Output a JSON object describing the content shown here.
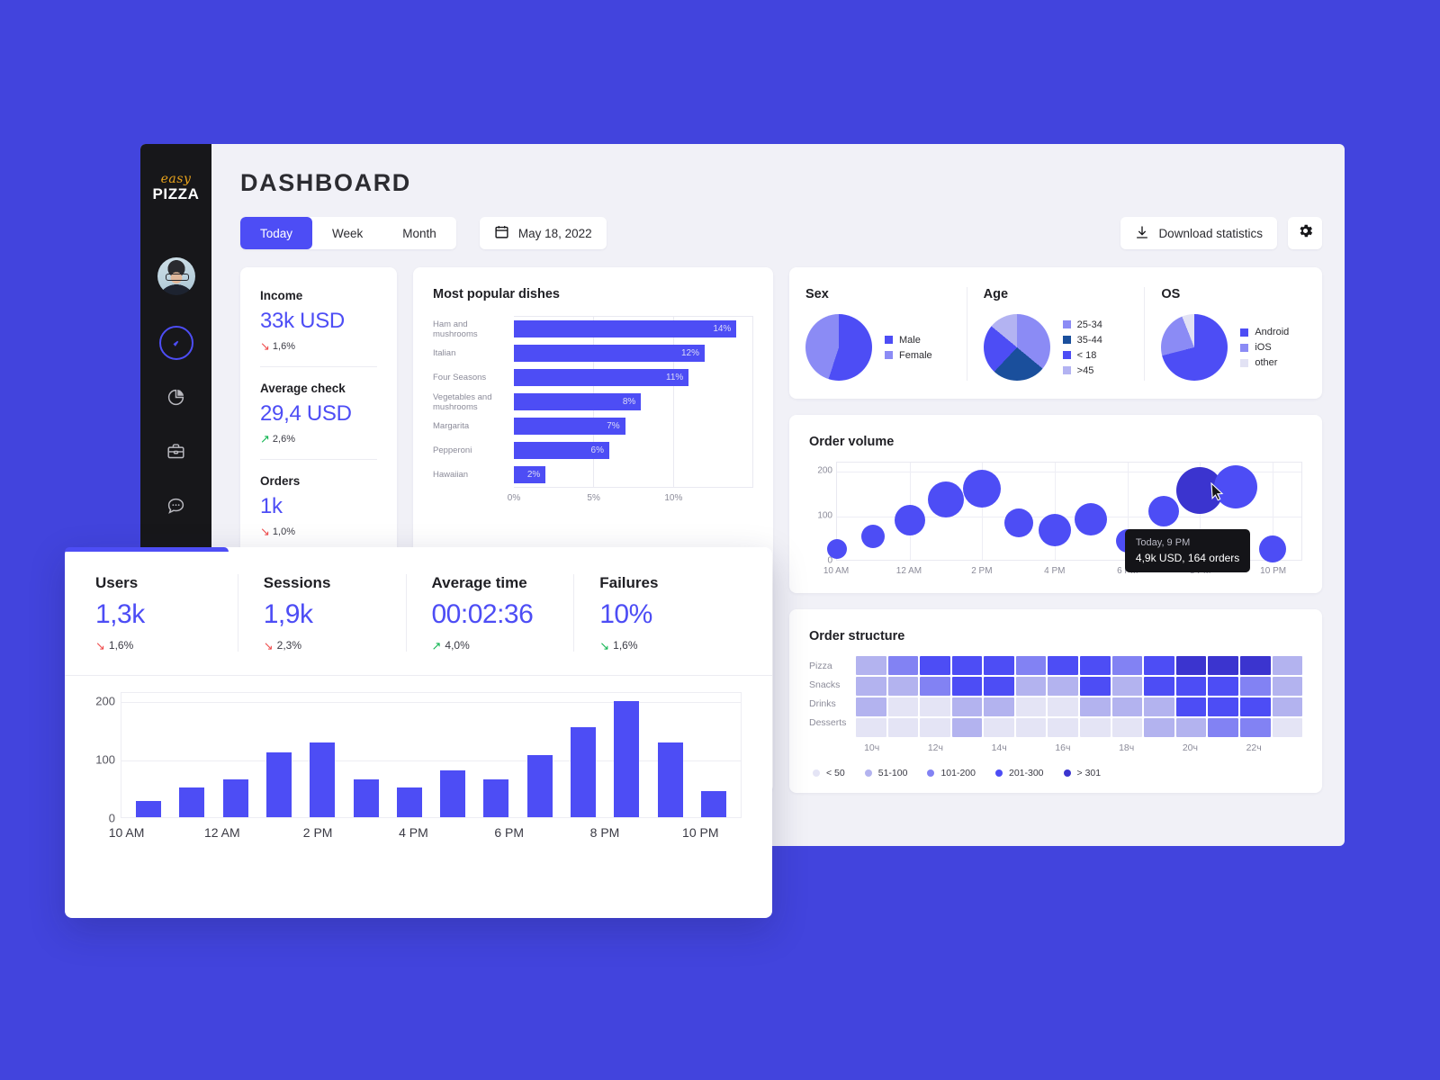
{
  "app": {
    "logo_top": "easy",
    "logo_bottom": "PIZZA",
    "title": "DASHBOARD"
  },
  "sidebar": {
    "items": [
      {
        "name": "avatar",
        "label": "User avatar"
      },
      {
        "name": "dashboard",
        "label": "Dashboard",
        "active": true
      },
      {
        "name": "analytics",
        "label": "Analytics",
        "active": false
      },
      {
        "name": "orders",
        "label": "Orders",
        "active": false
      },
      {
        "name": "messages",
        "label": "Messages",
        "active": false
      },
      {
        "name": "settings",
        "label": "Settings",
        "active": false
      }
    ]
  },
  "toolbar": {
    "segments": [
      {
        "label": "Today",
        "active": true
      },
      {
        "label": "Week",
        "active": false
      },
      {
        "label": "Month",
        "active": false
      }
    ],
    "date": "May 18, 2022",
    "download_label": "Download statistics",
    "settings_label": "Settings"
  },
  "kpi_card": {
    "items": [
      {
        "label": "Income",
        "value": "33k USD",
        "delta": "1,6%",
        "direction": "down",
        "tone": "negative"
      },
      {
        "label": "Average check",
        "value": "29,4 USD",
        "delta": "2,6%",
        "direction": "up",
        "tone": "positive"
      },
      {
        "label": "Orders",
        "value": "1k",
        "delta": "1,0%",
        "direction": "down",
        "tone": "negative"
      }
    ]
  },
  "overlay_kpis": {
    "items": [
      {
        "label": "Users",
        "value": "1,3k",
        "delta": "1,6%",
        "direction": "down",
        "tone": "negative"
      },
      {
        "label": "Sessions",
        "value": "1,9k",
        "delta": "2,3%",
        "direction": "down",
        "tone": "negative"
      },
      {
        "label": "Average time",
        "value": "00:02:36",
        "delta": "4,0%",
        "direction": "up",
        "tone": "positive"
      },
      {
        "label": "Failures",
        "value": "10%",
        "delta": "1,6%",
        "direction": "down",
        "tone": "positive"
      }
    ]
  },
  "colors": {
    "accent": "#4d4df5",
    "background": "#4244dd",
    "sidebar": "#17171a",
    "surface": "#ffffff",
    "canvas": "#f1f1f7",
    "positive": "#12b552",
    "negative": "#ef4b4b",
    "logo_accent": "#e8a31c"
  },
  "chart_data": [
    {
      "id": "most-popular-dishes",
      "type": "bar",
      "orientation": "horizontal",
      "title": "Most popular dishes",
      "categories": [
        "Ham and mushrooms",
        "Italian",
        "Four Seasons",
        "Vegetables and mushrooms",
        "Margarita",
        "Pepperoni",
        "Hawaiian"
      ],
      "values": [
        14,
        12,
        11,
        8,
        7,
        6,
        2
      ],
      "data_labels": [
        "14%",
        "12%",
        "11%",
        "8%",
        "7%",
        "6%",
        "2%"
      ],
      "xlabel": "",
      "ylabel": "",
      "xlim": [
        0,
        15
      ],
      "xticks": [
        0,
        5,
        10
      ],
      "xtick_labels": [
        "0%",
        "5%",
        "10%"
      ],
      "grid": true,
      "legend": "none",
      "series_color": "#4d4df5"
    },
    {
      "id": "sex",
      "type": "pie",
      "title": "Sex",
      "labels": [
        "Male",
        "Female"
      ],
      "values": [
        55,
        45
      ],
      "colors": [
        "#4d4df5",
        "#8b8bf5"
      ],
      "legend": "right"
    },
    {
      "id": "age",
      "type": "pie",
      "title": "Age",
      "labels": [
        "25-34",
        "35-44",
        "< 18",
        ">45"
      ],
      "values": [
        36,
        26,
        24,
        14
      ],
      "colors": [
        "#8b8bf5",
        "#1a4f9c",
        "#4d4df5",
        "#b3b3f2"
      ],
      "legend": "right"
    },
    {
      "id": "os",
      "type": "pie",
      "title": "OS",
      "labels": [
        "Android",
        "iOS",
        "other"
      ],
      "values": [
        71,
        23,
        6
      ],
      "colors": [
        "#4d4df5",
        "#8b8bf5",
        "#e2e2f4"
      ],
      "legend": "right"
    },
    {
      "id": "order-volume",
      "type": "scatter",
      "title": "Order volume",
      "ylabel": "",
      "ylim": [
        0,
        220
      ],
      "yticks": [
        0,
        100,
        200
      ],
      "ytick_labels": [
        "0",
        "100",
        "200"
      ],
      "xtick_labels": [
        "10 AM",
        "12 AM",
        "2 PM",
        "4 PM",
        "6 PM",
        "8 PM",
        "10 PM"
      ],
      "grid": true,
      "points": [
        {
          "x": 10,
          "y": 25,
          "size": 22
        },
        {
          "x": 11,
          "y": 52,
          "size": 26
        },
        {
          "x": 12,
          "y": 88,
          "size": 34
        },
        {
          "x": 13,
          "y": 135,
          "size": 40
        },
        {
          "x": 14,
          "y": 158,
          "size": 42
        },
        {
          "x": 15,
          "y": 83,
          "size": 32
        },
        {
          "x": 16,
          "y": 67,
          "size": 36
        },
        {
          "x": 17,
          "y": 91,
          "size": 36
        },
        {
          "x": 18,
          "y": 43,
          "size": 26
        },
        {
          "x": 19,
          "y": 108,
          "size": 34
        },
        {
          "x": 20,
          "y": 155,
          "size": 52,
          "highlighted": true
        },
        {
          "x": 21,
          "y": 162,
          "size": 48
        },
        {
          "x": 22,
          "y": 25,
          "size": 30
        }
      ],
      "tooltip": {
        "time": "Today, 9 PM",
        "value": "4,9k USD, 164 orders"
      }
    },
    {
      "id": "order-structure",
      "type": "heatmap",
      "title": "Order structure",
      "rows": [
        "Pizza",
        "Snacks",
        "Drinks",
        "Desserts"
      ],
      "xtick_labels": [
        "10ч",
        "12ч",
        "14ч",
        "16ч",
        "18ч",
        "20ч",
        "22ч"
      ],
      "levels": [
        {
          "label": "< 50",
          "color": "#e4e4f5"
        },
        {
          "label": "51-100",
          "color": "#b3b3ef"
        },
        {
          "label": "101-200",
          "color": "#8282f3"
        },
        {
          "label": "201-300",
          "color": "#4d4df5"
        },
        {
          "label": "> 301",
          "color": "#3b34cf"
        }
      ],
      "matrix": [
        [
          2,
          3,
          4,
          4,
          4,
          3,
          4,
          4,
          3,
          4,
          5,
          5,
          5,
          2
        ],
        [
          2,
          2,
          3,
          4,
          4,
          2,
          2,
          4,
          2,
          4,
          4,
          4,
          3,
          2
        ],
        [
          2,
          1,
          1,
          2,
          2,
          1,
          1,
          2,
          2,
          2,
          4,
          4,
          4,
          2
        ],
        [
          1,
          1,
          1,
          2,
          1,
          1,
          1,
          1,
          1,
          2,
          2,
          3,
          3,
          1
        ]
      ]
    },
    {
      "id": "hourly-volume",
      "type": "bar",
      "orientation": "vertical",
      "title": "",
      "ylim": [
        0,
        215
      ],
      "yticks": [
        0,
        100,
        200
      ],
      "ytick_labels": [
        "0",
        "100",
        "200"
      ],
      "values": [
        27,
        50,
        65,
        110,
        127,
        65,
        50,
        80,
        65,
        106,
        153,
        198,
        128,
        44
      ],
      "xtick_labels": [
        "10 AM",
        "12 AM",
        "2 PM",
        "4 PM",
        "6 PM",
        "8 PM",
        "10 PM"
      ],
      "grid": true,
      "series_color": "#4d4df5"
    }
  ]
}
